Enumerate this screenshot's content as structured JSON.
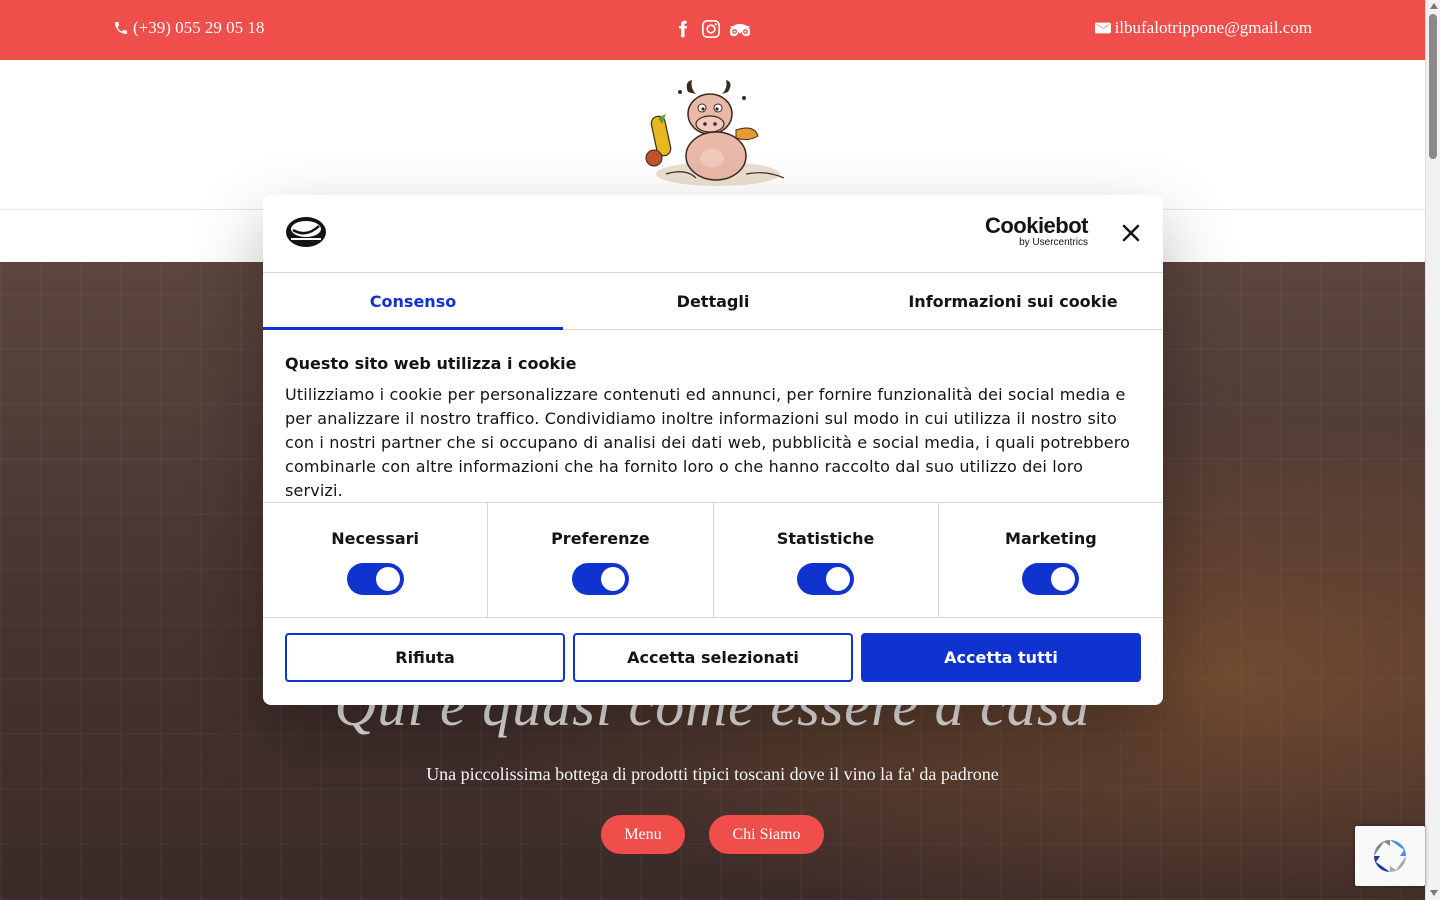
{
  "topbar": {
    "phone": "(+39) 055 29 05 18",
    "email": "ilbufalotrippone@gmail.com",
    "social_icons": [
      "facebook-icon",
      "instagram-icon",
      "tripadvisor-icon"
    ]
  },
  "hero": {
    "tagline": "Qui è quasi come essere a casa",
    "subtitle": "Una piccolissima bottega di prodotti tipici toscani dove il vino la fa' da padrone",
    "buttons": [
      {
        "label": "Menu"
      },
      {
        "label": "Chi Siamo"
      }
    ]
  },
  "cookie_dialog": {
    "brand": "Cookiebot",
    "brand_by": "by Usercentrics",
    "tabs": [
      {
        "label": "Consenso",
        "active": true
      },
      {
        "label": "Dettagli",
        "active": false
      },
      {
        "label": "Informazioni sui cookie",
        "active": false
      }
    ],
    "heading": "Questo sito web utilizza i cookie",
    "body": "Utilizziamo i cookie per personalizzare contenuti ed annunci, per fornire funzionalità dei social media e per analizzare il nostro traffico. Condividiamo inoltre informazioni sul modo in cui utilizza il nostro sito con i nostri partner che si occupano di analisi dei dati web, pubblicità e social media, i quali potrebbero combinarle con altre informazioni che ha fornito loro o che hanno raccolto dal suo utilizzo dei loro servizi.",
    "toggles": [
      {
        "label": "Necessari",
        "on": true
      },
      {
        "label": "Preferenze",
        "on": true
      },
      {
        "label": "Statistiche",
        "on": true
      },
      {
        "label": "Marketing",
        "on": true
      }
    ],
    "actions": {
      "reject": "Rifiuta",
      "accept_selected": "Accetta selezionati",
      "accept_all": "Accetta tutti"
    }
  },
  "colors": {
    "brand_red": "#ef4e4a",
    "cookiebot_blue": "#1032cf"
  }
}
